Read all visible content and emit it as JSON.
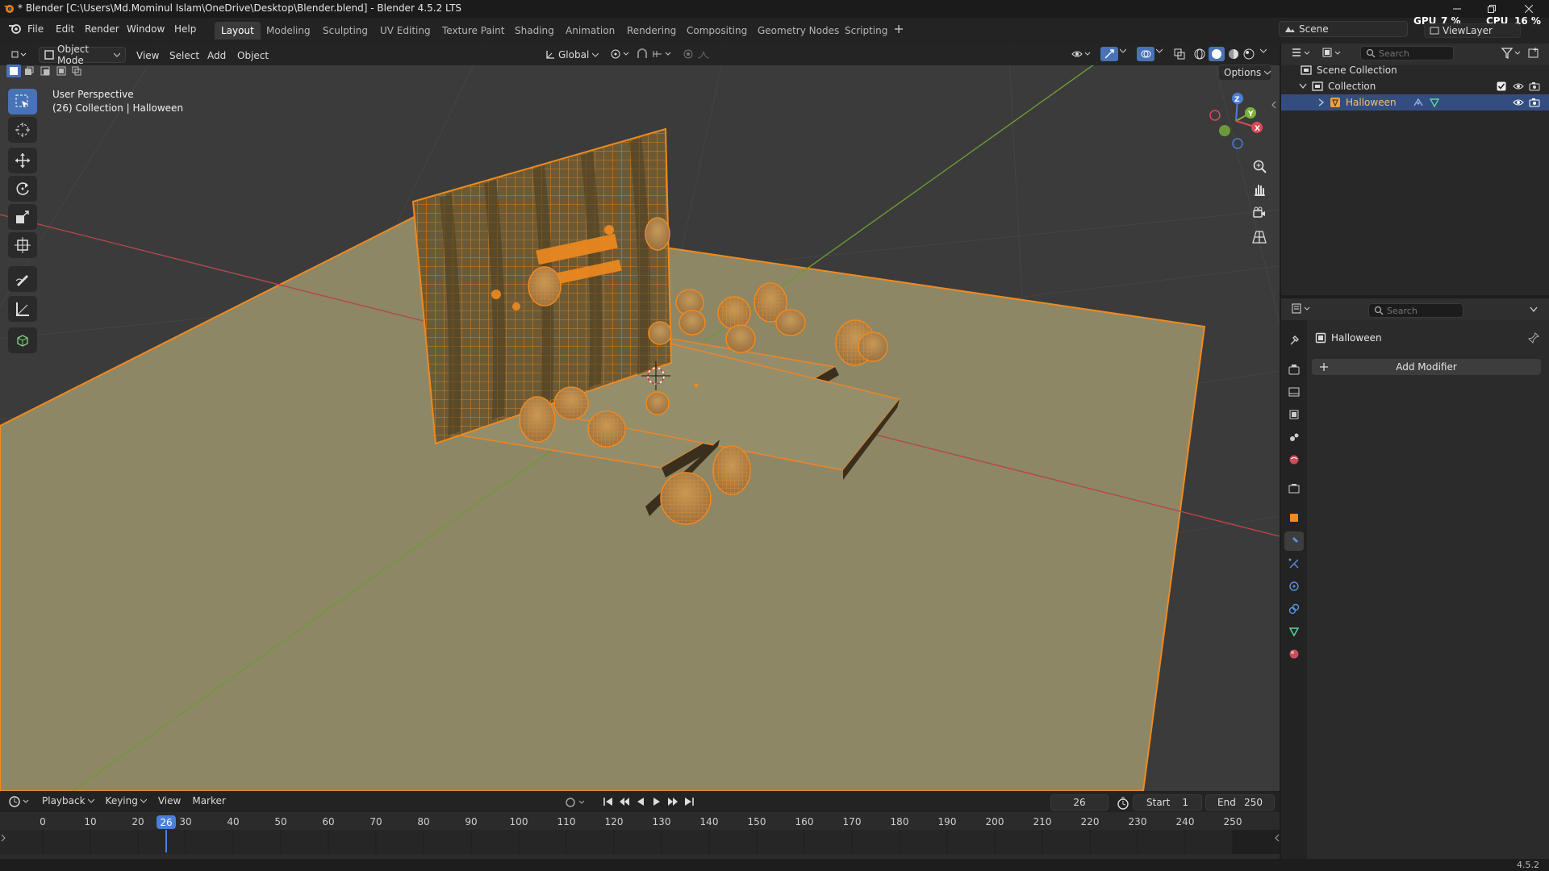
{
  "window": {
    "title": "* Blender [C:\\Users\\Md.Mominul Islam\\OneDrive\\Desktop\\Blender.blend] - Blender 4.5.2 LTS"
  },
  "menus": [
    "File",
    "Edit",
    "Render",
    "Window",
    "Help"
  ],
  "workspaces": [
    "Layout",
    "Modeling",
    "Sculpting",
    "UV Editing",
    "Texture Paint",
    "Shading",
    "Animation",
    "Rendering",
    "Compositing",
    "Geometry Nodes",
    "Scripting"
  ],
  "active_workspace": "Layout",
  "top_right": {
    "scene_name": "Scene",
    "view_layer": "ViewLayer",
    "gpu_label": "GPU",
    "gpu_value": "7 %",
    "cpu_label": "CPU",
    "cpu_value": "16 %"
  },
  "viewport": {
    "mode": "Object Mode",
    "menus": [
      "View",
      "Select",
      "Add",
      "Object"
    ],
    "transform_orientation": "Global",
    "options_label": "Options",
    "info_line1": "User Perspective",
    "info_line2": "(26) Collection | Halloween",
    "axis_labels": {
      "z": "Z",
      "y": "Y",
      "x": "X"
    }
  },
  "outliner": {
    "search_placeholder": "Search",
    "rows": [
      {
        "label": "Scene Collection",
        "level": 0
      },
      {
        "label": "Collection",
        "level": 1
      },
      {
        "label": "Halloween",
        "level": 2,
        "selected": true
      }
    ]
  },
  "properties": {
    "search_placeholder": "Search",
    "object_name": "Halloween",
    "add_modifier_label": "Add Modifier",
    "tabs": [
      "tool-icon",
      "render-icon",
      "output-icon",
      "view-layer-icon",
      "scene-icon",
      "world-icon",
      "collection-icon",
      "object-icon",
      "modifier-icon",
      "particles-icon",
      "physics-icon",
      "constraints-icon",
      "data-icon",
      "material-icon"
    ],
    "active_tab": "modifier-icon"
  },
  "timeline": {
    "menus": [
      "Playback",
      "Keying",
      "View",
      "Marker"
    ],
    "current_frame": "26",
    "start_label": "Start",
    "start_value": "1",
    "end_label": "End",
    "end_value": "250",
    "ticks": [
      "0",
      "10",
      "20",
      "30",
      "40",
      "50",
      "60",
      "70",
      "80",
      "90",
      "100",
      "110",
      "120",
      "130",
      "140",
      "150",
      "160",
      "170",
      "180",
      "190",
      "200",
      "210",
      "220",
      "230",
      "240",
      "250"
    ],
    "playhead_label": "26"
  },
  "status": {
    "version": "4.5.2"
  },
  "colors": {
    "selection_orange": "#f08a1e",
    "active_blue": "#4873b6",
    "floor": "#8e8765",
    "axis_x": "#b4474a",
    "axis_y": "#6c9a36"
  }
}
